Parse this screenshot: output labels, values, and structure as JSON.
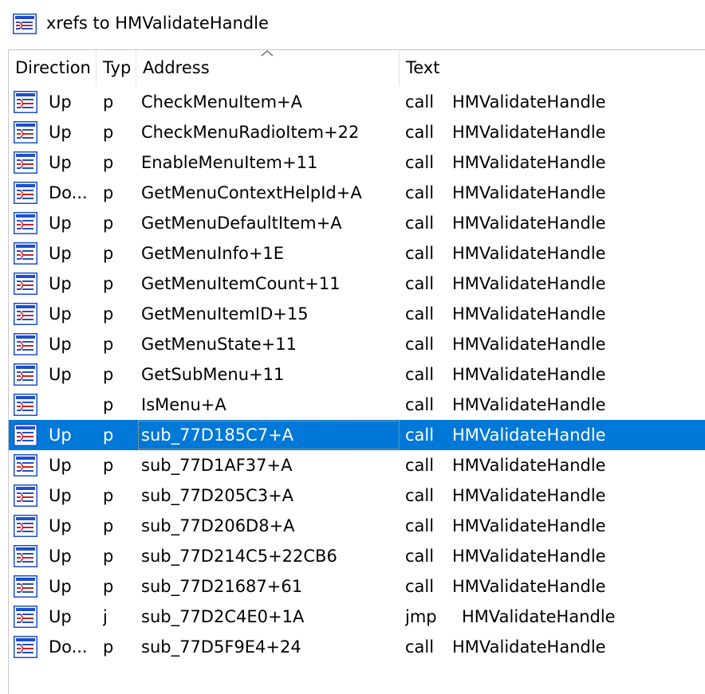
{
  "window": {
    "title": "xrefs to HMValidateHandle",
    "icon": "xref-list-icon"
  },
  "columns": [
    {
      "label": "Direction"
    },
    {
      "label": "Typ"
    },
    {
      "label": "Address"
    },
    {
      "label": "Text"
    }
  ],
  "sort_indicator": "sort-ascending-icon",
  "rows": [
    {
      "direction": "Up",
      "type": "p",
      "address": "CheckMenuItem+A",
      "instr": "call",
      "target": "HMValidateHandle"
    },
    {
      "direction": "Up",
      "type": "p",
      "address": "CheckMenuRadioItem+22",
      "instr": "call",
      "target": "HMValidateHandle"
    },
    {
      "direction": "Up",
      "type": "p",
      "address": "EnableMenuItem+11",
      "instr": "call",
      "target": "HMValidateHandle"
    },
    {
      "direction": "Do...",
      "type": "p",
      "address": "GetMenuContextHelpId+A",
      "instr": "call",
      "target": "HMValidateHandle"
    },
    {
      "direction": "Up",
      "type": "p",
      "address": "GetMenuDefaultItem+A",
      "instr": "call",
      "target": "HMValidateHandle"
    },
    {
      "direction": "Up",
      "type": "p",
      "address": "GetMenuInfo+1E",
      "instr": "call",
      "target": "HMValidateHandle"
    },
    {
      "direction": "Up",
      "type": "p",
      "address": "GetMenuItemCount+11",
      "instr": "call",
      "target": "HMValidateHandle"
    },
    {
      "direction": "Up",
      "type": "p",
      "address": "GetMenuItemID+15",
      "instr": "call",
      "target": "HMValidateHandle"
    },
    {
      "direction": "Up",
      "type": "p",
      "address": "GetMenuState+11",
      "instr": "call",
      "target": "HMValidateHandle"
    },
    {
      "direction": "Up",
      "type": "p",
      "address": "GetSubMenu+11",
      "instr": "call",
      "target": "HMValidateHandle"
    },
    {
      "direction": "",
      "type": "p",
      "address": "IsMenu+A",
      "instr": "call",
      "target": "HMValidateHandle"
    },
    {
      "direction": "Up",
      "type": "p",
      "address": "sub_77D185C7+A",
      "instr": "call",
      "target": "HMValidateHandle",
      "selected": true
    },
    {
      "direction": "Up",
      "type": "p",
      "address": "sub_77D1AF37+A",
      "instr": "call",
      "target": "HMValidateHandle"
    },
    {
      "direction": "Up",
      "type": "p",
      "address": "sub_77D205C3+A",
      "instr": "call",
      "target": "HMValidateHandle"
    },
    {
      "direction": "Up",
      "type": "p",
      "address": "sub_77D206D8+A",
      "instr": "call",
      "target": "HMValidateHandle"
    },
    {
      "direction": "Up",
      "type": "p",
      "address": "sub_77D214C5+22CB6",
      "instr": "call",
      "target": "HMValidateHandle"
    },
    {
      "direction": "Up",
      "type": "p",
      "address": "sub_77D21687+61",
      "instr": "call",
      "target": "HMValidateHandle"
    },
    {
      "direction": "Up",
      "type": "j",
      "address": "sub_77D2C4E0+1A",
      "instr": "jmp",
      "target": "HMValidateHandle"
    },
    {
      "direction": "Do...",
      "type": "p",
      "address": "sub_77D5F9E4+24",
      "instr": "call",
      "target": "HMValidateHandle"
    }
  ],
  "colors": {
    "selection": "#0078d7",
    "icon_blue": "#1f4fc8",
    "icon_red": "#d02020"
  }
}
